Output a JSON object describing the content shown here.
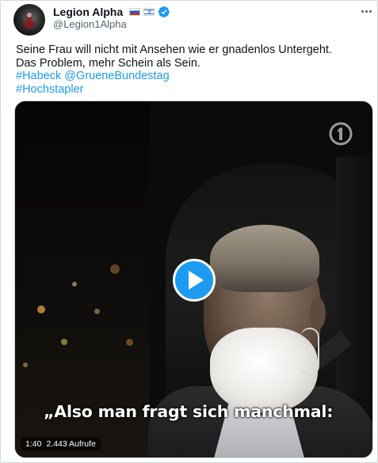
{
  "author": {
    "display_name": "Legion Alpha",
    "emoji": "",
    "flags": [
      "russia-flag",
      "israel-flag"
    ],
    "verified": true,
    "handle": "@Legion1Alpha"
  },
  "tweet": {
    "lines": [
      "Seine Frau will nicht mit Ansehen wie er gnadenlos Untergeht.",
      "Das Problem, mehr Schein als Sein."
    ],
    "hashtag_habeck": "#Habeck",
    "mention_gruene": "@GrueneBundestag",
    "hashtag_hochstapler": "#Hochstapler"
  },
  "video": {
    "subtitle": "„Also man fragt sich manchmal:",
    "duration": "1:40",
    "views": "2.443 Aufrufe",
    "channel_icon": "ard-one-logo-icon"
  },
  "colors": {
    "link": "#1d9bf0",
    "verified": "#1d9bf0",
    "play_button": "#1d9bf0",
    "text": "#0f1419",
    "secondary_text": "#536471"
  }
}
